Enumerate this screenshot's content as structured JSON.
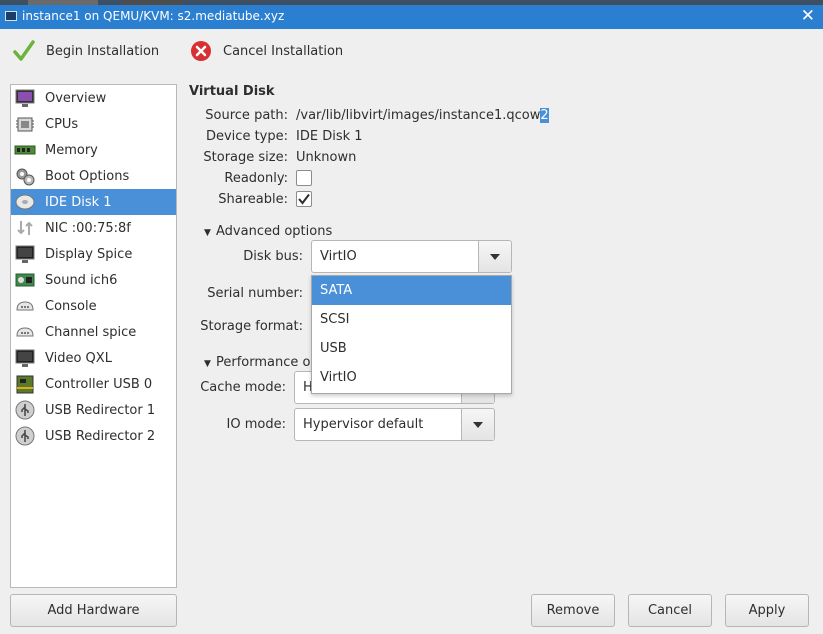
{
  "window": {
    "title": "instance1 on QEMU/KVM: s2.mediatube.xyz",
    "close_symbol": "✕"
  },
  "toolbar": {
    "begin_label": "Begin Installation",
    "cancel_label": "Cancel Installation"
  },
  "sidebar": {
    "items": [
      {
        "label": "Overview",
        "icon": "monitor-icon"
      },
      {
        "label": "CPUs",
        "icon": "cpu-icon"
      },
      {
        "label": "Memory",
        "icon": "memory-icon"
      },
      {
        "label": "Boot Options",
        "icon": "gears-icon"
      },
      {
        "label": "IDE Disk 1",
        "icon": "disk-icon"
      },
      {
        "label": "NIC :00:75:8f",
        "icon": "network-icon"
      },
      {
        "label": "Display Spice",
        "icon": "display-icon"
      },
      {
        "label": "Sound ich6",
        "icon": "sound-card-icon"
      },
      {
        "label": "Console",
        "icon": "serial-icon"
      },
      {
        "label": "Channel spice",
        "icon": "serial-icon"
      },
      {
        "label": "Video QXL",
        "icon": "display-icon"
      },
      {
        "label": "Controller USB 0",
        "icon": "controller-icon"
      },
      {
        "label": "USB Redirector 1",
        "icon": "usb-icon"
      },
      {
        "label": "USB Redirector 2",
        "icon": "usb-icon"
      }
    ],
    "selected_index": 4
  },
  "details": {
    "heading": "Virtual Disk",
    "source_path_label": "Source path:",
    "source_path_value": "/var/lib/libvirt/images/instance1.qcow",
    "source_path_selected": "2",
    "device_type_label": "Device type:",
    "device_type_value": "IDE Disk 1",
    "storage_size_label": "Storage size:",
    "storage_size_value": "Unknown",
    "readonly_label": "Readonly:",
    "readonly_checked": false,
    "shareable_label": "Shareable:",
    "shareable_checked": true
  },
  "advanced": {
    "header": "Advanced options",
    "disk_bus_label": "Disk bus:",
    "disk_bus_value": "VirtIO",
    "serial_label": "Serial number:",
    "storage_format_label": "Storage format:"
  },
  "performance": {
    "header": "Performance o",
    "cache_mode_label": "Cache mode:",
    "cache_mode_value": "H",
    "io_mode_label": "IO mode:",
    "io_mode_value": "Hypervisor default"
  },
  "dropdown": {
    "options": [
      "SATA",
      "SCSI",
      "USB",
      "VirtIO"
    ],
    "highlighted_index": 0
  },
  "buttons": {
    "add_hardware": "Add Hardware",
    "remove": "Remove",
    "cancel": "Cancel",
    "apply": "Apply"
  },
  "colors": {
    "titlebar": "#2a7fd0",
    "selection": "#4a90d9"
  }
}
